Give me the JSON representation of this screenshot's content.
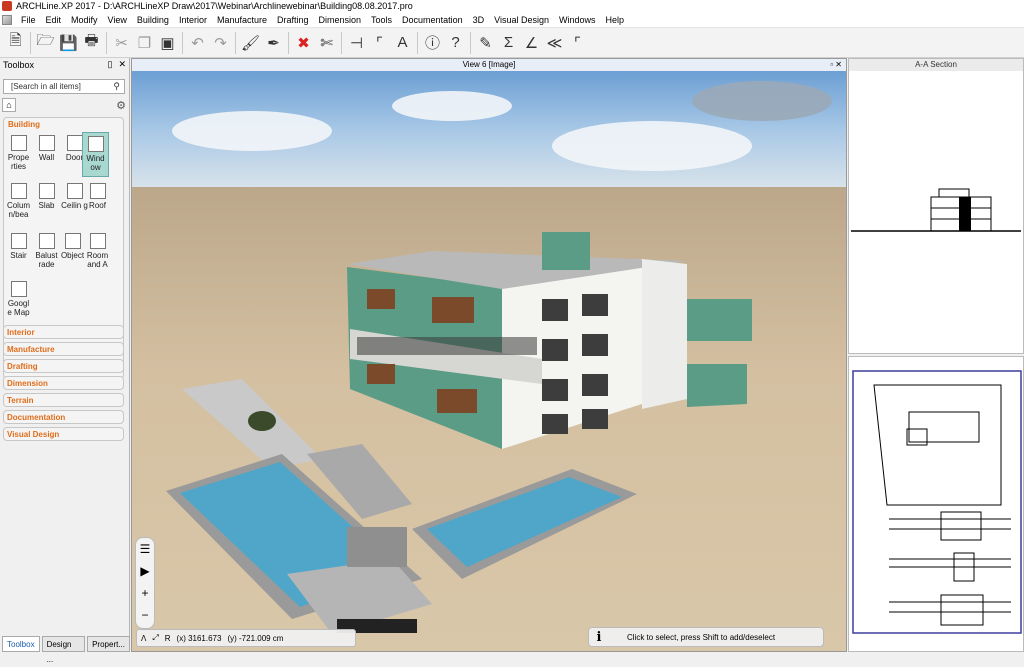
{
  "window": {
    "title": "ARCHLine.XP 2017 - D:\\ARCHLineXP Draw\\2017\\Webinar\\Archlinewebinar\\Building08.08.2017.pro"
  },
  "menu": [
    "File",
    "Edit",
    "Modify",
    "View",
    "Building",
    "Interior",
    "Manufacture",
    "Drafting",
    "Dimension",
    "Tools",
    "Documentation",
    "3D",
    "Visual Design",
    "Windows",
    "Help"
  ],
  "toolbox": {
    "title": "Toolbox",
    "search_placeholder": "[Search in all items]",
    "building_label": "Building",
    "tools": [
      {
        "label": "Prope rties",
        "icon": "properties-icon"
      },
      {
        "label": "Wall",
        "icon": "wall-icon"
      },
      {
        "label": "Door",
        "icon": "door-icon"
      },
      {
        "label": "Wind ow",
        "icon": "window-icon"
      },
      {
        "label": "Colum n/bea",
        "icon": "column-icon"
      },
      {
        "label": "Slab",
        "icon": "slab-icon"
      },
      {
        "label": "Ceilin g",
        "icon": "ceiling-icon"
      },
      {
        "label": "Roof",
        "icon": "roof-icon"
      },
      {
        "label": "Stair",
        "icon": "stair-icon"
      },
      {
        "label": "Balust rade",
        "icon": "balustrade-icon"
      },
      {
        "label": "Object",
        "icon": "object-icon"
      },
      {
        "label": "Room and A",
        "icon": "room-icon"
      },
      {
        "label": "Googl e Map",
        "icon": "google-map-icon"
      }
    ],
    "sections": [
      "Interior",
      "Manufacture",
      "Drafting",
      "Dimension",
      "Terrain",
      "Documentation",
      "Visual Design"
    ],
    "bottom_tabs": [
      "Toolbox",
      "Design ...",
      "Propert..."
    ]
  },
  "viewport": {
    "title": "View 6 [Image]",
    "coord_x": "(x) 3161.673",
    "coord_y": "(y) -721.009 cm",
    "status": "Click to select, press Shift to add/deselect"
  },
  "section_panel": {
    "title": "A-A Section"
  },
  "colors": {
    "accent": "#e06d1a",
    "building_green": "#5a9c86",
    "water": "#4fa6c8"
  }
}
